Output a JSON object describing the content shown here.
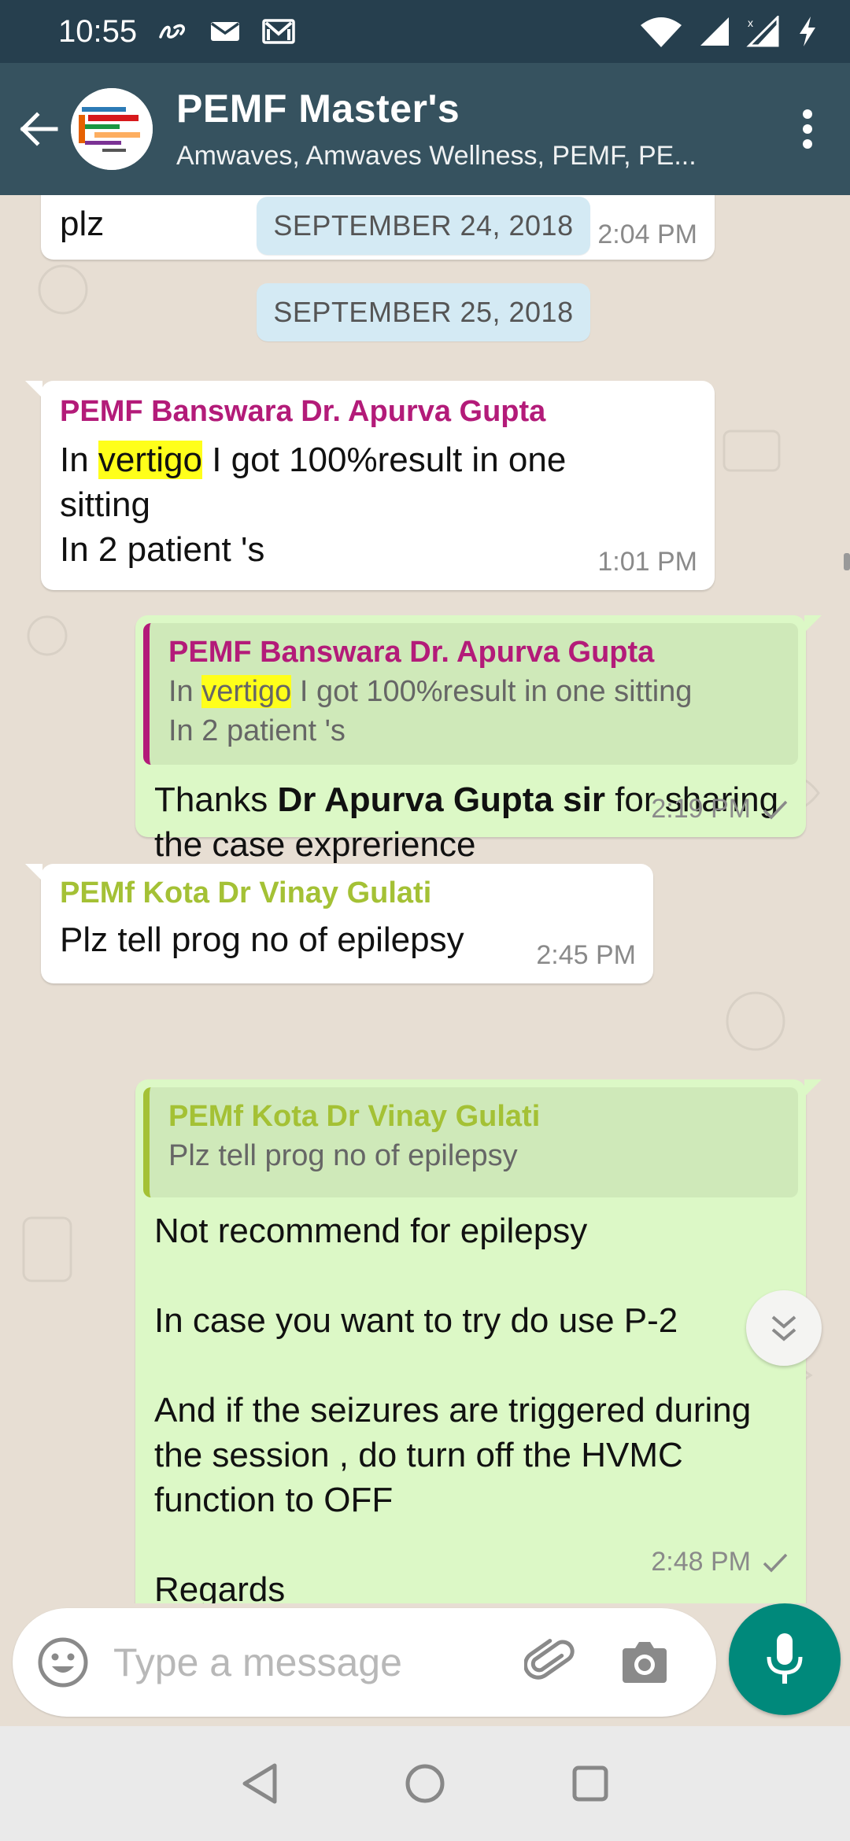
{
  "status_bar": {
    "time": "10:55",
    "icons": [
      "link-icon",
      "mail-icon",
      "gmail-icon",
      "wifi-icon",
      "signal-icon",
      "signal-x-icon",
      "charging-icon"
    ]
  },
  "header": {
    "title": "PEMF Master's",
    "subtitle": "Amwaves, Amwaves Wellness, PEMF, PE..."
  },
  "colors": {
    "status_bar": "#263f4e",
    "header": "#36525f",
    "outgoing_bubble": "#dcf8c6",
    "incoming_bubble": "#ffffff",
    "sender_magenta": "#b31b79",
    "sender_olive": "#a4c135",
    "mic_button": "#00897b",
    "highlight": "#ffff1a"
  },
  "messages": {
    "partial_top": {
      "text": "plz",
      "time": "2:04 PM"
    },
    "date_1": "SEPTEMBER 24, 2018",
    "date_2": "SEPTEMBER 25, 2018",
    "msg1": {
      "sender": "PEMF Banswara Dr. Apurva Gupta",
      "pre": "In ",
      "highlight": "vertigo",
      "post": " I got 100%result in one sitting",
      "line2": "In 2 patient 's",
      "time": "1:01 PM"
    },
    "msg2": {
      "quote_sender": "PEMF Banswara Dr. Apurva Gupta",
      "quote_pre": "In ",
      "quote_highlight": "vertigo",
      "quote_post": " I got 100%result in one sitting",
      "quote_line2": "In 2 patient 's",
      "text_pre": "Thanks ",
      "text_bold": "Dr Apurva Gupta sir",
      "text_post": " for sharing the case exprerience",
      "time": "2:19 PM"
    },
    "msg3": {
      "sender": "PEMf Kota Dr Vinay Gulati",
      "text": "Plz tell prog no of epilepsy",
      "time": "2:45 PM"
    },
    "msg4": {
      "quote_sender": "PEMf Kota Dr Vinay Gulati",
      "quote_text": "Plz tell prog no of epilepsy",
      "p1": "Not recommend for epilepsy",
      "p2": "In case you want to try do use P-2",
      "p3": "And if the seizures are triggered during the session , do turn off the HVMC function to OFF",
      "p4": "Regards",
      "time": "2:48 PM"
    }
  },
  "input": {
    "placeholder": "Type a message"
  }
}
